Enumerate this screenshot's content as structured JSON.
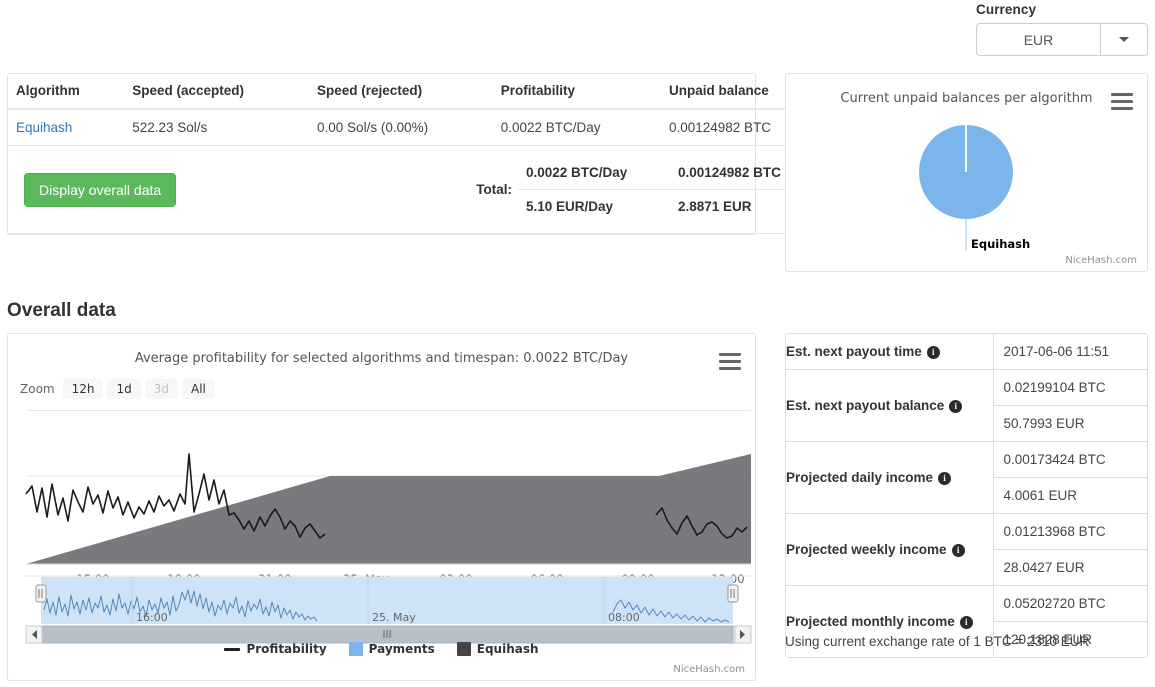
{
  "currency": {
    "label": "Currency",
    "selected": "EUR",
    "caret_icon": "chevron-down-icon",
    "options": [
      "EUR"
    ]
  },
  "algorithms_table": {
    "headers": [
      "Algorithm",
      "Speed (accepted)",
      "Speed (rejected)",
      "Profitability",
      "Unpaid balance"
    ],
    "rows": [
      {
        "algorithm": "Equihash",
        "speed_accepted": "522.23 Sol/s",
        "speed_rejected": "0.00 Sol/s (0.00%)",
        "profitability": "0.0022 BTC/Day",
        "unpaid_balance": "0.00124982 BTC"
      }
    ],
    "overall_button": "Display overall data",
    "total_label": "Total:",
    "totals": [
      {
        "profitability": "0.0022 BTC/Day",
        "unpaid_balance": "0.00124982 BTC"
      },
      {
        "profitability": "5.10 EUR/Day",
        "unpaid_balance": "2.8871 EUR"
      }
    ]
  },
  "pie_panel": {
    "title": "Current unpaid balances per algorithm",
    "menu_icon": "hamburger-menu-icon",
    "credit": "NiceHash.com"
  },
  "overall": {
    "heading": "Overall data"
  },
  "main_chart": {
    "title": "Average profitability for selected algorithms and timespan: 0.0022 BTC/Day",
    "menu_icon": "hamburger-menu-icon",
    "zoom_label": "Zoom",
    "zoom_buttons": [
      {
        "label": "12h",
        "state": "enabled"
      },
      {
        "label": "1d",
        "state": "enabled"
      },
      {
        "label": "3d",
        "state": "disabled"
      },
      {
        "label": "All",
        "state": "enabled"
      }
    ],
    "credit": "NiceHash.com",
    "scroll_left_icon": "arrow-left-icon",
    "scroll_right_icon": "arrow-right-icon"
  },
  "payout_table": {
    "rows": [
      {
        "label": "Est. next payout time",
        "values": [
          "2017-06-06 11:51"
        ]
      },
      {
        "label": "Est. next payout balance",
        "values": [
          "0.02199104 BTC",
          "50.7993 EUR"
        ]
      },
      {
        "label": "Projected daily income",
        "values": [
          "0.00173424 BTC",
          "4.0061 EUR"
        ]
      },
      {
        "label": "Projected weekly income",
        "values": [
          "0.01213968 BTC",
          "28.0427 EUR"
        ]
      },
      {
        "label": "Projected monthly income",
        "values": [
          "0.05202720 BTC",
          "120.1828 EUR"
        ]
      }
    ],
    "info_icon": "info-icon"
  },
  "exchange_note": "Using current exchange rate of 1 BTC = 2310 EUR",
  "colors": {
    "accent_green": "#5cb85c",
    "link_blue": "#337ab7",
    "payments_blue": "#7cb5ec",
    "equihash_gray": "#434348",
    "profitability_line": "#1a1a1a",
    "navigator_fill": "#cfe3f7"
  },
  "chart_data": {
    "type": "area",
    "title": "Average profitability for selected algorithms and timespan: 0.0022 BTC/Day",
    "xlabel": "",
    "ylabel": "",
    "grid": false,
    "legend_position": "bottom",
    "xticks": [
      "15:00",
      "18:00",
      "21:00",
      "25. May",
      "03:00",
      "06:00",
      "09:00",
      "12:00"
    ],
    "navigator_xticks": [
      "16:00",
      "25. May",
      "08:00"
    ],
    "series": [
      {
        "name": "Profitability",
        "type": "line",
        "color": "#1a1a1a",
        "x": [
          0,
          1,
          2,
          3,
          4,
          5,
          6,
          7,
          8,
          9,
          10,
          11,
          12,
          13,
          14,
          15,
          16,
          17,
          18,
          19,
          20,
          21,
          22,
          23,
          24,
          25,
          26,
          27,
          28,
          29,
          30,
          31,
          32,
          33,
          34,
          35,
          36,
          37,
          38,
          39,
          40,
          41,
          42,
          43,
          44,
          45,
          46,
          47,
          48,
          49,
          50,
          51,
          52,
          53,
          54,
          55,
          56,
          57,
          58,
          59,
          60,
          61,
          62
        ],
        "values": [
          0.003,
          0.0025,
          0.0034,
          0.0022,
          0.0031,
          0.0021,
          0.0033,
          0.0019,
          0.0029,
          0.0024,
          0.0033,
          0.0026,
          0.003,
          0.0022,
          0.0031,
          0.0026,
          0.0033,
          0.0023,
          0.0028,
          0.0024,
          0.0031,
          0.0025,
          0.0029,
          0.0027,
          0.003,
          0.0026,
          0.0029,
          0.0025,
          0.0039,
          0.0024,
          0.0032,
          0.0026,
          0.0036,
          0.0029,
          0.003,
          0.0027,
          0.0026,
          0.0023,
          0.0022,
          0.0024,
          0.0021,
          0.0023,
          0.0026,
          0.0022,
          0.0021,
          0.0025,
          0.0022,
          0.0019,
          0.0021,
          0.0023,
          0.002,
          null,
          null,
          null,
          null,
          null,
          null,
          0.0024,
          0.0021,
          0.0023,
          0.0019,
          0.0018,
          0.002
        ],
        "gap_note": "series has no data between ~22:30 and ~09:30"
      },
      {
        "name": "Equihash",
        "type": "area",
        "color": "#434348",
        "description": "cumulative unpaid balance area rising from 0 to plateau at 25. May, flat through 09:30, then rising again to 12:00"
      },
      {
        "name": "Payments",
        "type": "column",
        "color": "#7cb5ec",
        "values": []
      }
    ]
  }
}
